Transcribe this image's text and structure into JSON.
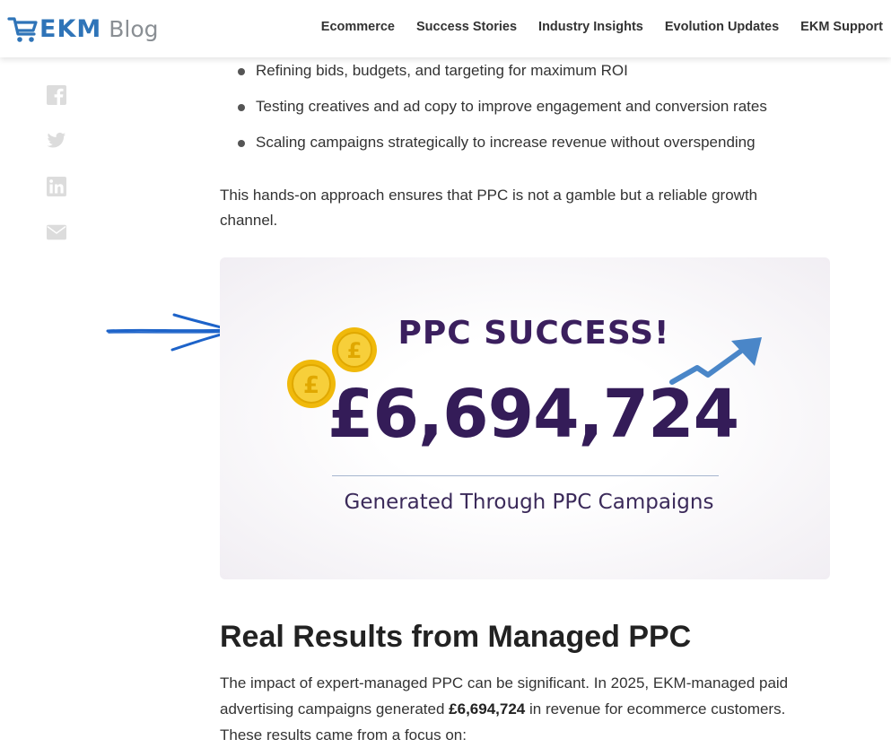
{
  "header": {
    "logo_text": "EKM",
    "logo_suffix": "Blog",
    "nav": [
      "Ecommerce",
      "Success Stories",
      "Industry Insights",
      "Evolution Updates",
      "EKM Support"
    ]
  },
  "share_icons": [
    "facebook-icon",
    "twitter-icon",
    "linkedin-icon",
    "email-icon"
  ],
  "bullets": [
    "Refining bids, budgets, and targeting for maximum ROI",
    "Testing creatives and ad copy to improve engagement and conversion rates",
    "Scaling campaigns strategically to increase revenue without overspending"
  ],
  "paragraph1": "This hands-on approach ensures that PPC is not a gamble but a reliable growth channel.",
  "banner": {
    "title": "PPC SUCCESS!",
    "amount": "£6,694,724",
    "subtitle": "Generated Through PPC Campaigns",
    "coin_symbol": "£"
  },
  "section": {
    "heading": "Real Results from Managed PPC",
    "para_before": "The impact of expert-managed PPC can be significant. In 2025, EKM-managed paid advertising campaigns generated ",
    "para_bold": "£6,694,724",
    "para_after": " in revenue for ecommerce customers. These results came from a focus on:"
  },
  "colors": {
    "brand_blue": "#2f74b8",
    "banner_purple": "#341c58",
    "coin_gold": "#f5c518",
    "trend_blue": "#4a86c8",
    "annotation_arrow": "#1d63c9"
  }
}
